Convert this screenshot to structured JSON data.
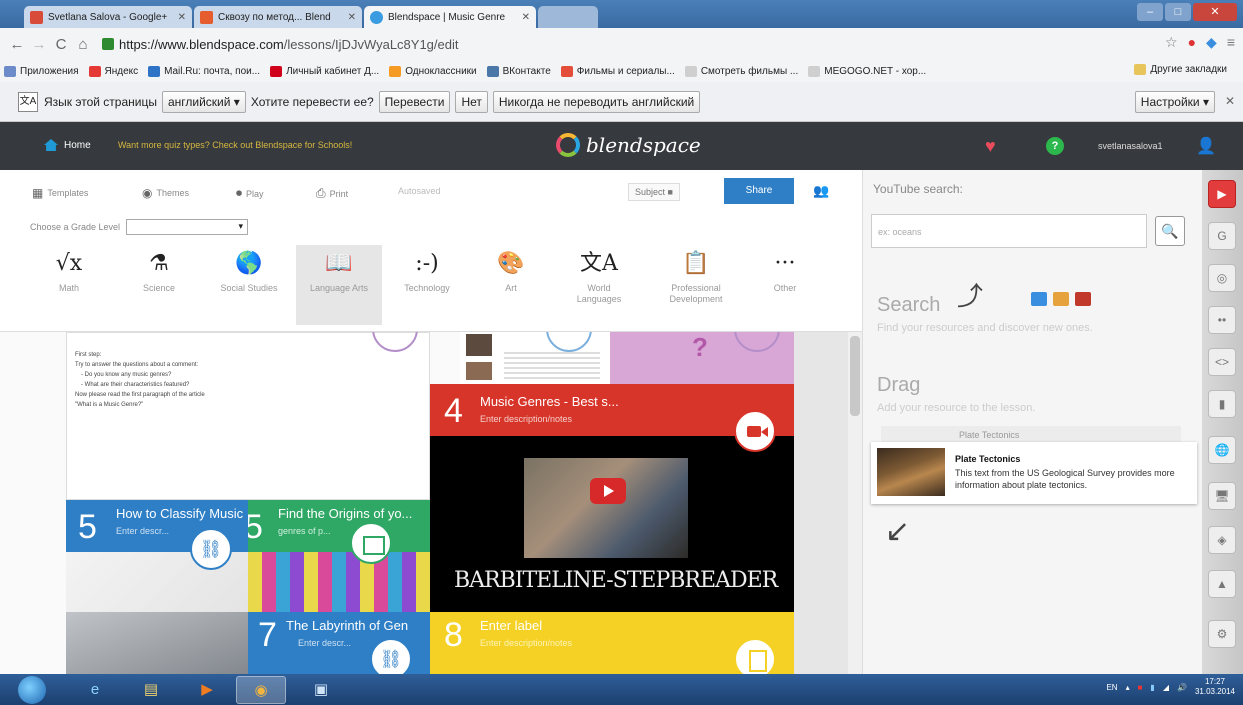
{
  "browser": {
    "tabs": [
      {
        "label": "Svetlana Salova - Google+",
        "favicon_color": "#d94b39"
      },
      {
        "label": "Сквозу по метод... Blend",
        "favicon_color": "#e55c2f"
      },
      {
        "label": "Blendspace | Music Genre",
        "favicon_color": "#3a9be0"
      }
    ],
    "url_host": "https://www.blendspace.com",
    "url_path": "/lessons/IjDJvWyaLc8Y1g/edit",
    "bookmarks": [
      {
        "label": "Приложения",
        "color": "#6b8cc8"
      },
      {
        "label": "Яндекс",
        "color": "#e53935"
      },
      {
        "label": "Mail.Ru: почта, пои...",
        "color": "#2f73c6"
      },
      {
        "label": "Личный кабинет Д...",
        "color": "#d0021b"
      },
      {
        "label": "Одноклассники",
        "color": "#f59a23"
      },
      {
        "label": "ВКонтакте",
        "color": "#4a76a8"
      },
      {
        "label": "Фильмы и сериалы...",
        "color": "#e54d3b"
      },
      {
        "label": "Смотреть фильмы ...",
        "color": "#cfcfcf"
      },
      {
        "label": "MEGOGO.NET - хор...",
        "color": "#cfcfcf"
      }
    ],
    "bookmarks_other": "Другие закладки",
    "translate": {
      "prompt": "Язык этой страницы",
      "language": "английский",
      "question": "Хотите перевести ее?",
      "translate_btn": "Перевести",
      "no_btn": "Нет",
      "never_btn": "Никогда не переводить английский",
      "settings_btn": "Настройки"
    }
  },
  "app": {
    "home": "Home",
    "promo": "Want more quiz types? Check out Blendspace for Schools!",
    "logo": "blendspace",
    "username": "svetlanasalova1"
  },
  "toolbar": {
    "templates": "Templates",
    "themes": "Themes",
    "play": "Play",
    "print": "Print",
    "autosaved": "Autosaved",
    "subject": "Subject",
    "share": "Share"
  },
  "grade": {
    "label": "Choose a Grade Level",
    "value": ""
  },
  "subjects": [
    {
      "glyph": "√x",
      "label": "Math"
    },
    {
      "glyph": "⚗",
      "label": "Science"
    },
    {
      "glyph": "🌎",
      "label": "Social Studies"
    },
    {
      "glyph": "📖",
      "label": "Language Arts"
    },
    {
      "glyph": ":-)",
      "label": "Technology"
    },
    {
      "glyph": "🎨",
      "label": "Art"
    },
    {
      "glyph": "文A",
      "label": "World Languages"
    },
    {
      "glyph": "📋",
      "label": "Professional Development"
    },
    {
      "glyph": "···",
      "label": "Other"
    }
  ],
  "doc_tile": {
    "lines": [
      "First step:",
      "Try to answer the questions about a comment:",
      "- Do you know any music genres?",
      "- What are their characteristics featured?",
      "Now please read the first paragraph of the article",
      "\"What is a Music Genre?\""
    ]
  },
  "tiles": {
    "t4": {
      "number": "4",
      "title": "Music Genres - Best s...",
      "desc": "Enter description/notes"
    },
    "t5a": {
      "number": "5",
      "title": "How to Classify Music",
      "desc": "Enter descr..."
    },
    "t5b": {
      "number": "5",
      "title": "Find the Origins of yo...",
      "desc": "genres of p..."
    },
    "t7": {
      "number": "7",
      "title": "The Labyrinth of Gen",
      "desc": "Enter descr..."
    },
    "t8": {
      "number": "8",
      "title": "Enter label",
      "desc": "Enter description/notes"
    },
    "video_caption": "BARBITELINE-STEPBREADER"
  },
  "panel": {
    "yt_label": "YouTube search:",
    "yt_placeholder": "ex: oceans",
    "search_title": "Search",
    "search_sub": "Find your resources and discover new ones.",
    "drag_title": "Drag",
    "drag_sub": "Add your resource to the lesson.",
    "result_bg_title": "Plate Tectonics",
    "result_title": "Plate Tectonics",
    "result_desc": "This text from the US Geological Survey provides more information about plate tectonics."
  },
  "taskbar": {
    "lang": "EN",
    "time": "17:27",
    "date": "31.03.2014"
  }
}
